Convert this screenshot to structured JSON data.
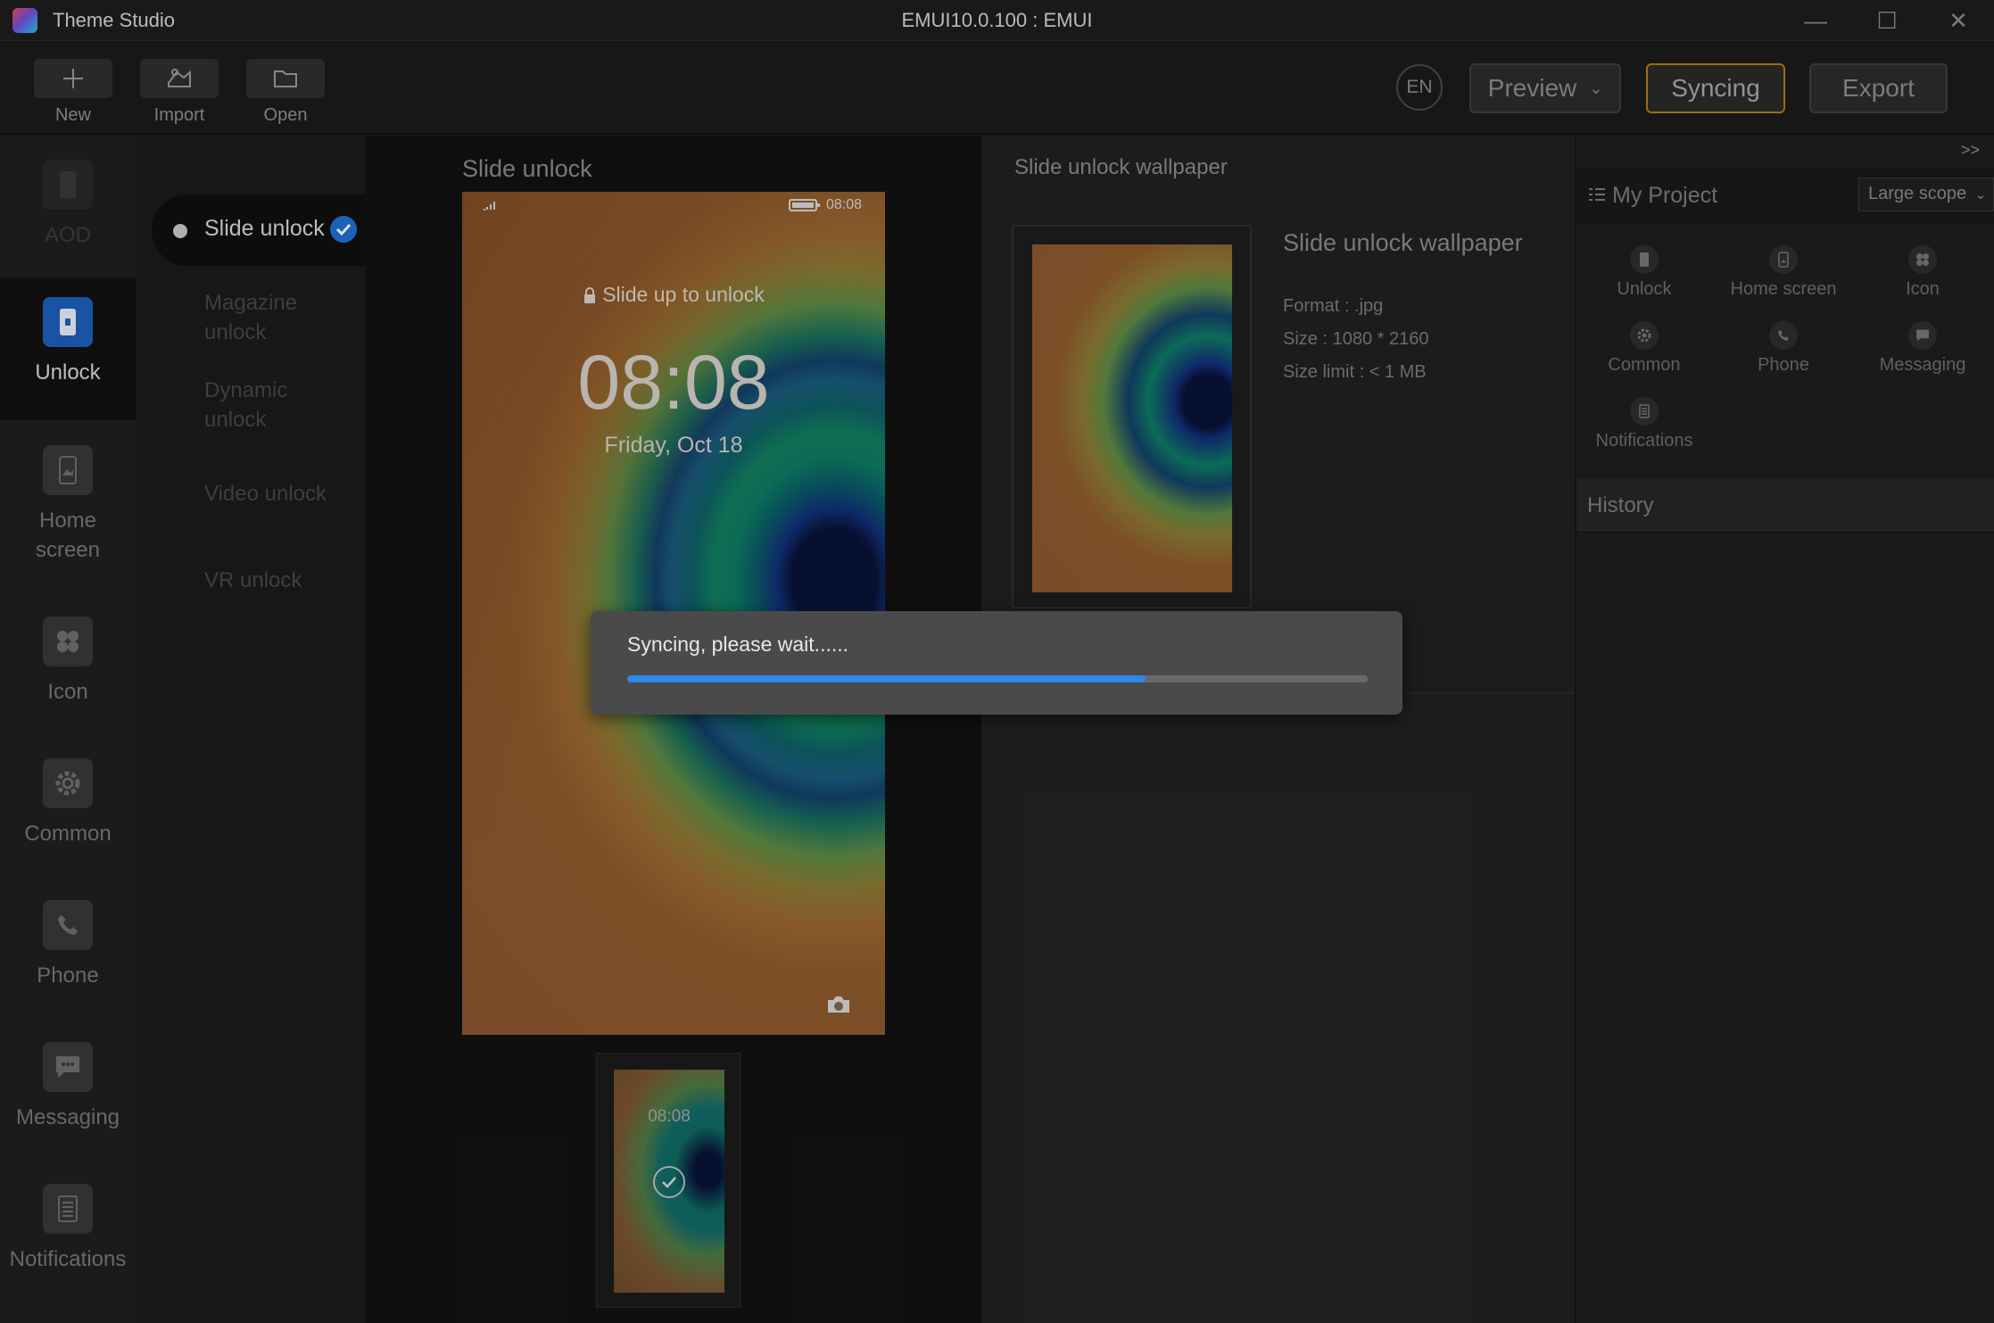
{
  "titlebar": {
    "app_name": "Theme Studio",
    "window_title": "EMUI10.0.100 : EMUI"
  },
  "toolbar": {
    "new_label": "New",
    "import_label": "Import",
    "open_label": "Open",
    "lang_label": "EN",
    "preview_label": "Preview",
    "syncing_label": "Syncing",
    "export_label": "Export"
  },
  "leftnav": {
    "aod": "AOD",
    "unlock": "Unlock",
    "home_screen": "Home screen",
    "icon": "Icon",
    "common": "Common",
    "phone": "Phone",
    "messaging": "Messaging",
    "notifications": "Notifications"
  },
  "subnav": {
    "slide_unlock": "Slide unlock",
    "magazine_unlock": "Magazine unlock",
    "dynamic_unlock": "Dynamic unlock",
    "video_unlock": "Video unlock",
    "vr_unlock": "VR unlock"
  },
  "preview": {
    "title": "Slide unlock",
    "status_time": "08:08",
    "lock_text": "Slide up to unlock",
    "clock": "08:08",
    "date": "Friday, Oct 18",
    "thumb_clock": "08:08"
  },
  "detail": {
    "header": "Slide unlock wallpaper",
    "name": "Slide unlock wallpaper",
    "format": "Format :  .jpg",
    "size": "Size :  1080 * 2160",
    "size_limit": "Size limit :  < 1 MB"
  },
  "project": {
    "collapse": ">>",
    "title": "My Project",
    "scope": "Large scope",
    "items": [
      "Unlock",
      "Home screen",
      "Icon",
      "Common",
      "Phone",
      "Messaging",
      "Notifications"
    ],
    "history": "History"
  },
  "modal": {
    "message": "Syncing, please wait......",
    "progress": 0.7
  },
  "colors": {
    "accent": "#2f87e6",
    "syncing_border": "#b77a16",
    "nav_selected": "#1d5fb8"
  }
}
